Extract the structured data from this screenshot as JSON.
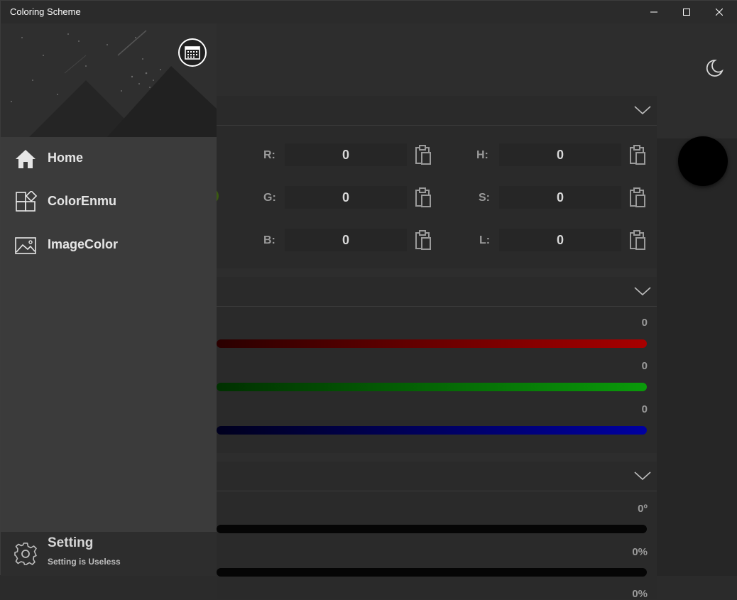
{
  "window": {
    "title": "Coloring Scheme"
  },
  "drawer": {
    "nav": [
      {
        "label": "Home",
        "icon": "home-icon"
      },
      {
        "label": "ColorEnmu",
        "icon": "color-enum-icon"
      },
      {
        "label": "ImageColor",
        "icon": "image-icon"
      }
    ],
    "setting": {
      "label": "Setting",
      "subtitle": "Setting is Useless",
      "icon": "gear-icon"
    }
  },
  "rgb_hsl": {
    "r_label": "R:",
    "r_value": "0",
    "g_label": "G:",
    "g_value": "0",
    "b_label": "B:",
    "b_value": "0",
    "h_label": "H:",
    "h_value": "0",
    "s_label": "S:",
    "s_value": "0",
    "l_label": "L:",
    "l_value": "0"
  },
  "sliders": {
    "red_value": "0",
    "green_value": "0",
    "blue_value": "0"
  },
  "hsl_sliders": {
    "hue_value": "0º",
    "saturation_value": "0%",
    "lightness_value": "0%"
  },
  "preview_color": "#000000",
  "colors": {
    "red": "#a80000",
    "green": "#0a9a0a",
    "blue": "#0000a0",
    "bg": "#2d2d2d",
    "drawer": "#3b3b3b"
  }
}
